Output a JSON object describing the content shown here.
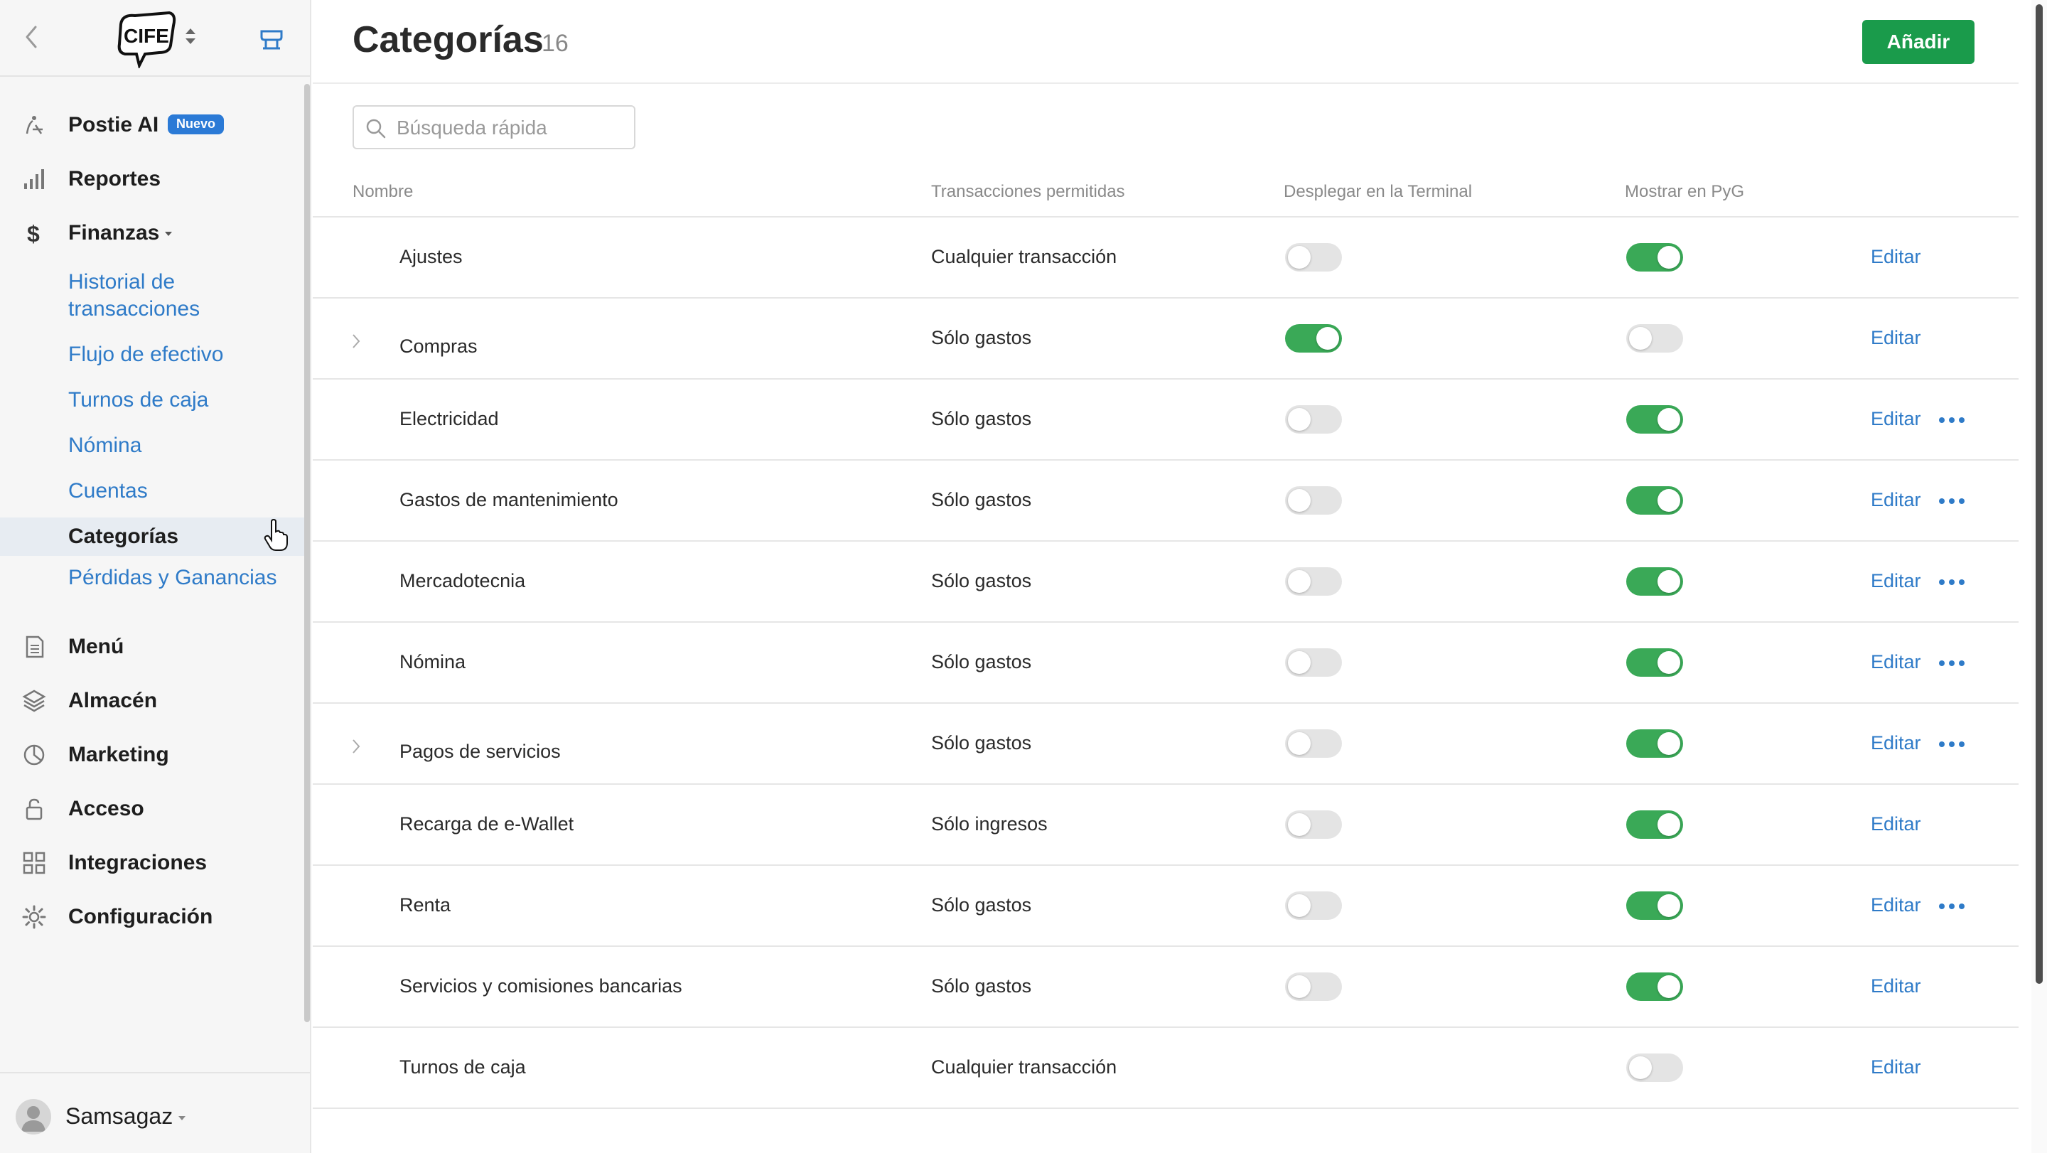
{
  "sidebar": {
    "logo_text": "CIFE",
    "nav_top": [
      {
        "label": "Postie AI",
        "icon": "sparkle-person-icon",
        "badge": "Nuevo"
      },
      {
        "label": "Reportes",
        "icon": "bar-chart-icon"
      },
      {
        "label": "Finanzas",
        "icon": "dollar-icon"
      }
    ],
    "finanzas_sub": [
      {
        "label": "Historial de transacciones"
      },
      {
        "label": "Flujo de efectivo"
      },
      {
        "label": "Turnos de caja"
      },
      {
        "label": "Nómina"
      },
      {
        "label": "Cuentas"
      },
      {
        "label": "Categorías",
        "active": true
      },
      {
        "label": "Pérdidas y Ganancias"
      }
    ],
    "nav_bottom": [
      {
        "label": "Menú",
        "icon": "document-icon"
      },
      {
        "label": "Almacén",
        "icon": "layers-icon"
      },
      {
        "label": "Marketing",
        "icon": "pie-icon"
      },
      {
        "label": "Acceso",
        "icon": "lock-icon"
      },
      {
        "label": "Integraciones",
        "icon": "grid-icon"
      },
      {
        "label": "Configuración",
        "icon": "gear-icon"
      }
    ],
    "user": "Samsagaz"
  },
  "header": {
    "title": "Categorías",
    "count": "16",
    "add_label": "Añadir"
  },
  "search": {
    "placeholder": "Búsqueda rápida",
    "value": ""
  },
  "table": {
    "columns": {
      "name": "Nombre",
      "allowed": "Transacciones permitidas",
      "terminal": "Desplegar en la Terminal",
      "pyg": "Mostrar en PyG"
    },
    "edit_label": "Editar",
    "rows": [
      {
        "name": "Ajustes",
        "allowed": "Cualquier transacción",
        "expandable": false,
        "terminal": false,
        "pyg": true,
        "more": false
      },
      {
        "name": "Compras",
        "allowed": "Sólo gastos",
        "expandable": true,
        "terminal": true,
        "pyg": false,
        "more": false
      },
      {
        "name": "Electricidad",
        "allowed": "Sólo gastos",
        "expandable": false,
        "terminal": false,
        "pyg": true,
        "more": true
      },
      {
        "name": "Gastos de mantenimiento",
        "allowed": "Sólo gastos",
        "expandable": false,
        "terminal": false,
        "pyg": true,
        "more": true
      },
      {
        "name": "Mercadotecnia",
        "allowed": "Sólo gastos",
        "expandable": false,
        "terminal": false,
        "pyg": true,
        "more": true
      },
      {
        "name": "Nómina",
        "allowed": "Sólo gastos",
        "expandable": false,
        "terminal": false,
        "pyg": true,
        "more": true
      },
      {
        "name": "Pagos de servicios",
        "allowed": "Sólo gastos",
        "expandable": true,
        "terminal": false,
        "pyg": true,
        "more": true
      },
      {
        "name": "Recarga de e-Wallet",
        "allowed": "Sólo ingresos",
        "expandable": false,
        "terminal": false,
        "pyg": true,
        "more": false
      },
      {
        "name": "Renta",
        "allowed": "Sólo gastos",
        "expandable": false,
        "terminal": false,
        "pyg": true,
        "more": true
      },
      {
        "name": "Servicios y comisiones bancarias",
        "allowed": "Sólo gastos",
        "expandable": false,
        "terminal": false,
        "pyg": true,
        "more": false
      },
      {
        "name": "Turnos de caja",
        "allowed": "Cualquier transacción",
        "expandable": false,
        "terminal": null,
        "pyg": false,
        "more": false
      }
    ]
  },
  "colors": {
    "accent_green": "#1a9b4b",
    "toggle_on": "#3aa957",
    "link_blue": "#2f7bc8",
    "badge_blue": "#2b7ad6"
  }
}
